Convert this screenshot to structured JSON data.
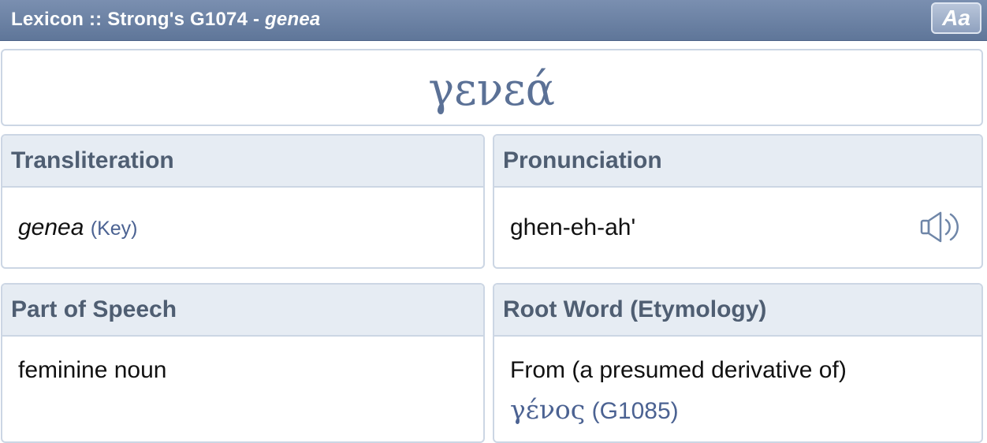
{
  "header": {
    "title_prefix": "Lexicon :: Strong's G1074 - ",
    "title_word": "genea",
    "font_button_label": "Aa"
  },
  "lemma": "γενεά",
  "transliteration": {
    "heading": "Transliteration",
    "value": "genea",
    "key_label": "(Key)"
  },
  "pronunciation": {
    "heading": "Pronunciation",
    "value": "ghen-eh-ah'",
    "audio_icon": "speaker-icon"
  },
  "part_of_speech": {
    "heading": "Part of Speech",
    "value": "feminine noun"
  },
  "root_word": {
    "heading": "Root Word (Etymology)",
    "text": "From (a presumed derivative of)",
    "greek_link": "γένος",
    "strongs_link": "(G1085)"
  },
  "colors": {
    "titlebar": "#6a80a4",
    "accent": "#5b7196",
    "link": "#4b6292",
    "card_header": "#e6ecf3",
    "border": "#ccd6e4"
  }
}
